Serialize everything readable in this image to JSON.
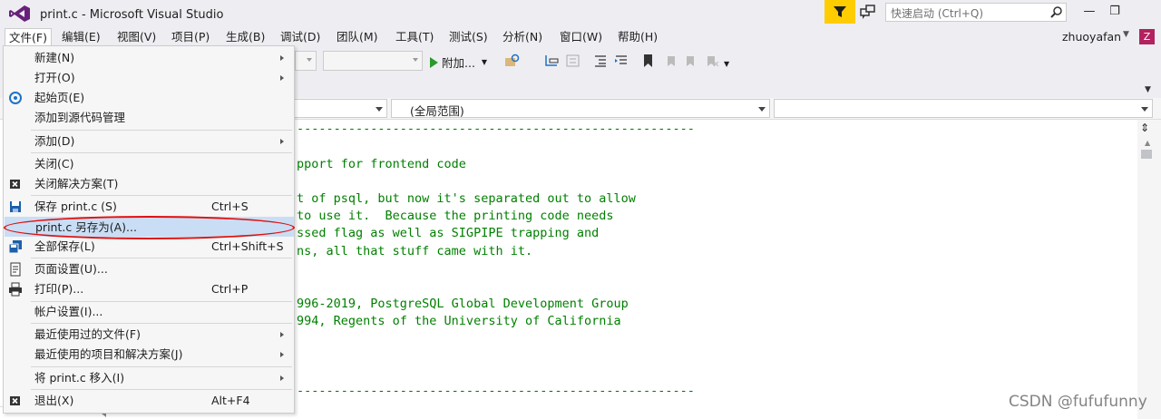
{
  "window": {
    "title": "print.c - Microsoft Visual Studio",
    "quick_launch_placeholder": "快速启动 (Ctrl+Q)",
    "minimize": "—",
    "restore": "❐",
    "user": "zhuoyafan",
    "avatar_initial": "Z"
  },
  "menubar": {
    "items": [
      "文件(F)",
      "编辑(E)",
      "视图(V)",
      "项目(P)",
      "生成(B)",
      "调试(D)",
      "团队(M)",
      "工具(T)",
      "测试(S)",
      "分析(N)",
      "窗口(W)",
      "帮助(H)"
    ]
  },
  "toolbar": {
    "attach_label": "附加..."
  },
  "navbar": {
    "scope": "(全局范围)"
  },
  "code": {
    "lines": [
      "------------------------------------------------------",
      "pport for frontend code",
      "t of psql, but now it's separated out to allow",
      "to use it.  Because the printing code needs",
      "ssed flag as well as SIGPIPE trapping and",
      "ns, all that stuff came with it.",
      "996-2019, PostgreSQL Global Development Group",
      "994, Regents of the University of California",
      "------------------------------------------------------"
    ]
  },
  "file_menu": {
    "items": [
      {
        "label": "新建(N)",
        "shortcut": "",
        "submenu": true,
        "icon": ""
      },
      {
        "label": "打开(O)",
        "shortcut": "",
        "submenu": true,
        "icon": ""
      },
      {
        "label": "起始页(E)",
        "shortcut": "",
        "submenu": false,
        "icon": "start-page-icon"
      },
      {
        "label": "添加到源代码管理",
        "shortcut": "",
        "submenu": false,
        "icon": ""
      },
      {
        "label": "添加(D)",
        "shortcut": "",
        "submenu": true,
        "icon": ""
      },
      {
        "label": "关闭(C)",
        "shortcut": "",
        "submenu": false,
        "icon": ""
      },
      {
        "label": "关闭解决方案(T)",
        "shortcut": "",
        "submenu": false,
        "icon": "close-solution-icon"
      },
      {
        "label": "保存 print.c (S)",
        "shortcut": "Ctrl+S",
        "submenu": false,
        "icon": "save-icon"
      },
      {
        "label": "print.c 另存为(A)...",
        "shortcut": "",
        "submenu": false,
        "icon": ""
      },
      {
        "label": "全部保存(L)",
        "shortcut": "Ctrl+Shift+S",
        "submenu": false,
        "icon": "save-all-icon"
      },
      {
        "label": "页面设置(U)...",
        "shortcut": "",
        "submenu": false,
        "icon": "page-setup-icon"
      },
      {
        "label": "打印(P)...",
        "shortcut": "Ctrl+P",
        "submenu": false,
        "icon": "print-icon"
      },
      {
        "label": "帐户设置(I)...",
        "shortcut": "",
        "submenu": false,
        "icon": ""
      },
      {
        "label": "最近使用过的文件(F)",
        "shortcut": "",
        "submenu": true,
        "icon": ""
      },
      {
        "label": "最近使用的项目和解决方案(J)",
        "shortcut": "",
        "submenu": true,
        "icon": ""
      },
      {
        "label": "将 print.c 移入(I)",
        "shortcut": "",
        "submenu": true,
        "icon": ""
      },
      {
        "label": "退出(X)",
        "shortcut": "Alt+F4",
        "submenu": false,
        "icon": "exit-icon"
      }
    ]
  },
  "watermark": "CSDN @fufufunny",
  "colors": {
    "accent_yellow": "#ffcc00",
    "highlight": "#c9def5",
    "annotation_red": "#e01010",
    "code_comment": "#008000",
    "avatar": "#b2225e"
  }
}
